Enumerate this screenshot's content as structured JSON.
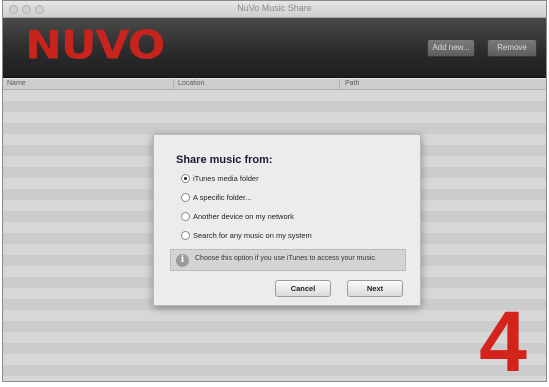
{
  "window": {
    "title": "NuVo Music Share"
  },
  "header": {
    "logo_text": "NUVO",
    "logo_mark": "®",
    "add_button": "Add new...",
    "remove_button": "Remove"
  },
  "table": {
    "columns": [
      "Name",
      "Location",
      "Path"
    ],
    "rows": []
  },
  "dialog": {
    "title": "Share music from:",
    "options": [
      {
        "label": "iTunes media folder",
        "selected": true
      },
      {
        "label": "A specific folder...",
        "selected": false
      },
      {
        "label": "Another device on my network",
        "selected": false
      },
      {
        "label": "Search for any music on my system",
        "selected": false
      }
    ],
    "info_text": "Choose this option if you use iTunes to access your music.",
    "info_icon": "info-icon",
    "cancel_button": "Cancel",
    "next_button": "Next"
  },
  "step_number": "4",
  "colors": {
    "brand_red": "#c8231c",
    "header_dark": "#2a2a2a",
    "step_red": "#d4231b"
  }
}
